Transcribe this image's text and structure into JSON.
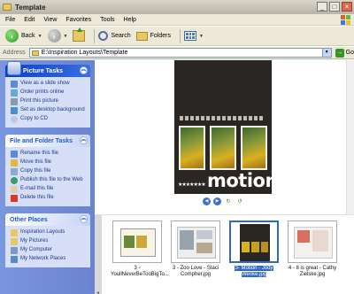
{
  "window": {
    "title": "Template",
    "min": "_",
    "max": "□",
    "close": "×"
  },
  "menu": [
    "File",
    "Edit",
    "View",
    "Favorites",
    "Tools",
    "Help"
  ],
  "toolbar": {
    "back": "Back",
    "search": "Search",
    "folders": "Folders"
  },
  "address": {
    "label": "Address",
    "path": "E:\\Inspiration Layouts\\Template",
    "go": "Go"
  },
  "sidebar": {
    "picture_tasks": {
      "title": "Picture Tasks",
      "items": [
        "View as a slide show",
        "Order prints online",
        "Print this picture",
        "Set as desktop background",
        "Copy to CD"
      ]
    },
    "file_tasks": {
      "title": "File and Folder Tasks",
      "items": [
        "Rename this file",
        "Move this file",
        "Copy this file",
        "Publish this file to the Web",
        "E-mail this file",
        "Delete this file"
      ]
    },
    "other_places": {
      "title": "Other Places",
      "items": [
        "Inspiration Layouts",
        "My Pictures",
        "My Computer",
        "My Network Places"
      ]
    }
  },
  "preview": {
    "word": "motion",
    "stars": "★★★★★★★"
  },
  "thumbnails": [
    {
      "caption": "3 - YoullNeverBeTooBigTo...",
      "selected": false
    },
    {
      "caption": "3 - Zoo Love - Staci Compher.jpg",
      "selected": false
    },
    {
      "caption": "3- Motion - Jody Wenke.jpg",
      "selected": true
    },
    {
      "caption": "4 - 8 is great - Cathy Zielske.jpg",
      "selected": false
    }
  ],
  "colors": {
    "accent": "#316ac5",
    "sidebar": "#7a96df",
    "link": "#1a3a8a"
  }
}
